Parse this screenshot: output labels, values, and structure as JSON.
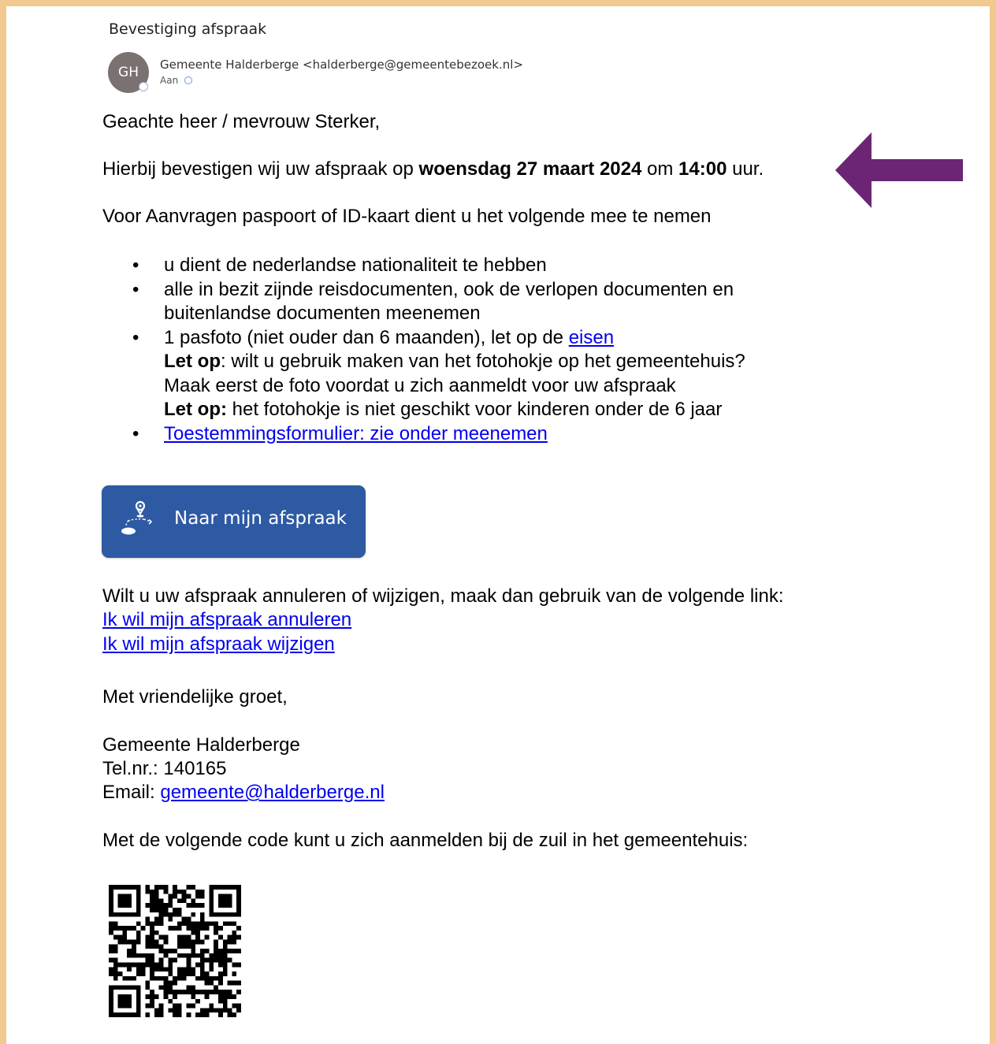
{
  "email": {
    "subject": "Bevestiging afspraak",
    "avatar_initials": "GH",
    "sender": "Gemeente Halderberge <halderberge@gemeentebezoek.nl>",
    "to_label": "Aan"
  },
  "body": {
    "greeting": "Geachte heer / mevrouw Sterker,",
    "confirm_prefix": "Hierbij bevestigen wij uw afspraak op ",
    "confirm_date": "woensdag 27 maart 2024",
    "confirm_mid": " om ",
    "confirm_time": "14:00",
    "confirm_suffix": " uur.",
    "intro": "Voor Aanvragen paspoort of ID-kaart dient u het volgende mee te nemen",
    "bullet1": "u dient de nederlandse nationaliteit te hebben",
    "bullet2_line1": "alle in bezit zijnde reisdocumenten, ook de verlopen documenten en",
    "bullet2_line2": "buitenlandse documenten meenemen",
    "bullet3_prefix": "1 pasfoto (niet ouder dan 6 maanden), let op de ",
    "bullet3_link": "eisen",
    "letop1_bold": "Let op",
    "letop1_text": ": wilt u gebruik maken van het fotohokje op het gemeentehuis?",
    "letop1_line2": "Maak eerst de foto voordat u zich aanmeldt voor uw afspraak",
    "letop2_bold": "Let op:",
    "letop2_text": " het fotohokje is niet geschikt voor kinderen onder de 6 jaar",
    "bullet4_link": "Toestemmingsformulier: zie onder meenemen",
    "cta_label": "Naar mijn afspraak",
    "change_text": "Wilt u uw afspraak annuleren of wijzigen, maak dan gebruik van de volgende link:",
    "cancel_link": "Ik wil mijn afspraak annuleren",
    "modify_link": "Ik wil mijn afspraak wijzigen",
    "closing": "Met vriendelijke groet,",
    "org_name": "Gemeente Halderberge",
    "tel": "Tel.nr.: 140165",
    "email_label": "Email: ",
    "email_link": "gemeente@halderberge.nl",
    "code_text": "Met de volgende code kunt u zich aanmelden bij de zuil in het gemeentehuis:"
  },
  "colors": {
    "frame": "#f2c98f",
    "cta_background": "#2e5aa3",
    "arrow": "#6b2574",
    "link": "#0000ee"
  }
}
